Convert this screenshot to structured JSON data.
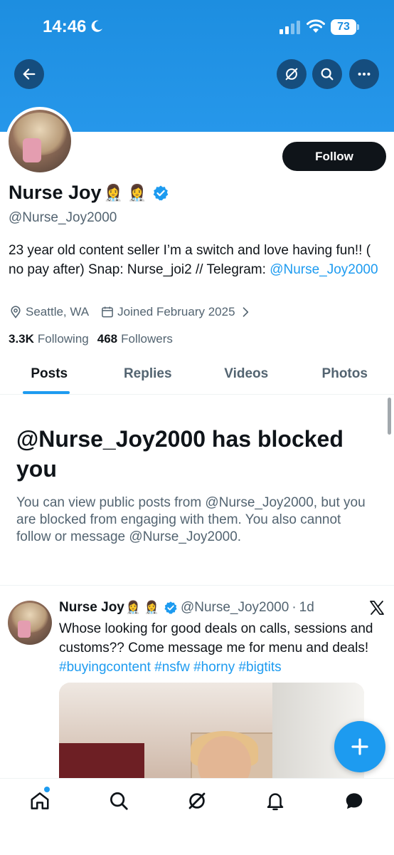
{
  "status_bar": {
    "time": "14:46",
    "battery": "73"
  },
  "header": {
    "icons": [
      "back-arrow-icon",
      "grok-icon",
      "search-icon",
      "more-icon"
    ]
  },
  "profile": {
    "display_name": "Nurse Joy",
    "name_emoji": "👩‍⚕️ 👩‍⚕️",
    "handle": "@Nurse_Joy2000",
    "follow_label": "Follow",
    "bio_text": "23 year old content seller I’m a switch and love having fun!! ( no pay after) Snap: Nurse_joi2 // Telegram: ",
    "bio_link": "@Nurse_Joy2000",
    "location": "Seattle, WA",
    "joined": "Joined February 2025",
    "following_count": "3.3K",
    "following_label": "Following",
    "followers_count": "468",
    "followers_label": "Followers"
  },
  "tabs": [
    {
      "label": "Posts",
      "active": true
    },
    {
      "label": "Replies",
      "active": false
    },
    {
      "label": "Videos",
      "active": false
    },
    {
      "label": "Photos",
      "active": false
    }
  ],
  "blocked": {
    "title": "@Nurse_Joy2000 has blocked you",
    "message": "You can view public posts from @Nurse_Joy2000, but you are blocked from engaging with them. You also cannot follow or message @Nurse_Joy2000."
  },
  "post": {
    "author_name": "Nurse Joy",
    "author_emoji": "👩‍⚕️ 👩‍⚕️",
    "handle": "@Nurse_Joy2000",
    "separator": "·",
    "time": "1d",
    "text": "Whose looking for good deals on calls, sessions and customs?? Come message me for menu and deals! ",
    "hashtags": [
      "#buyingcontent",
      "#nsfw",
      "#horny",
      "#bigtits"
    ]
  },
  "bottom_nav": [
    "home-icon",
    "search-icon",
    "grok-icon",
    "notifications-icon",
    "messages-icon"
  ],
  "colors": {
    "accent": "#1d9bf0",
    "banner": "#1d8ee0",
    "text": "#0f1419",
    "muted": "#536471"
  }
}
